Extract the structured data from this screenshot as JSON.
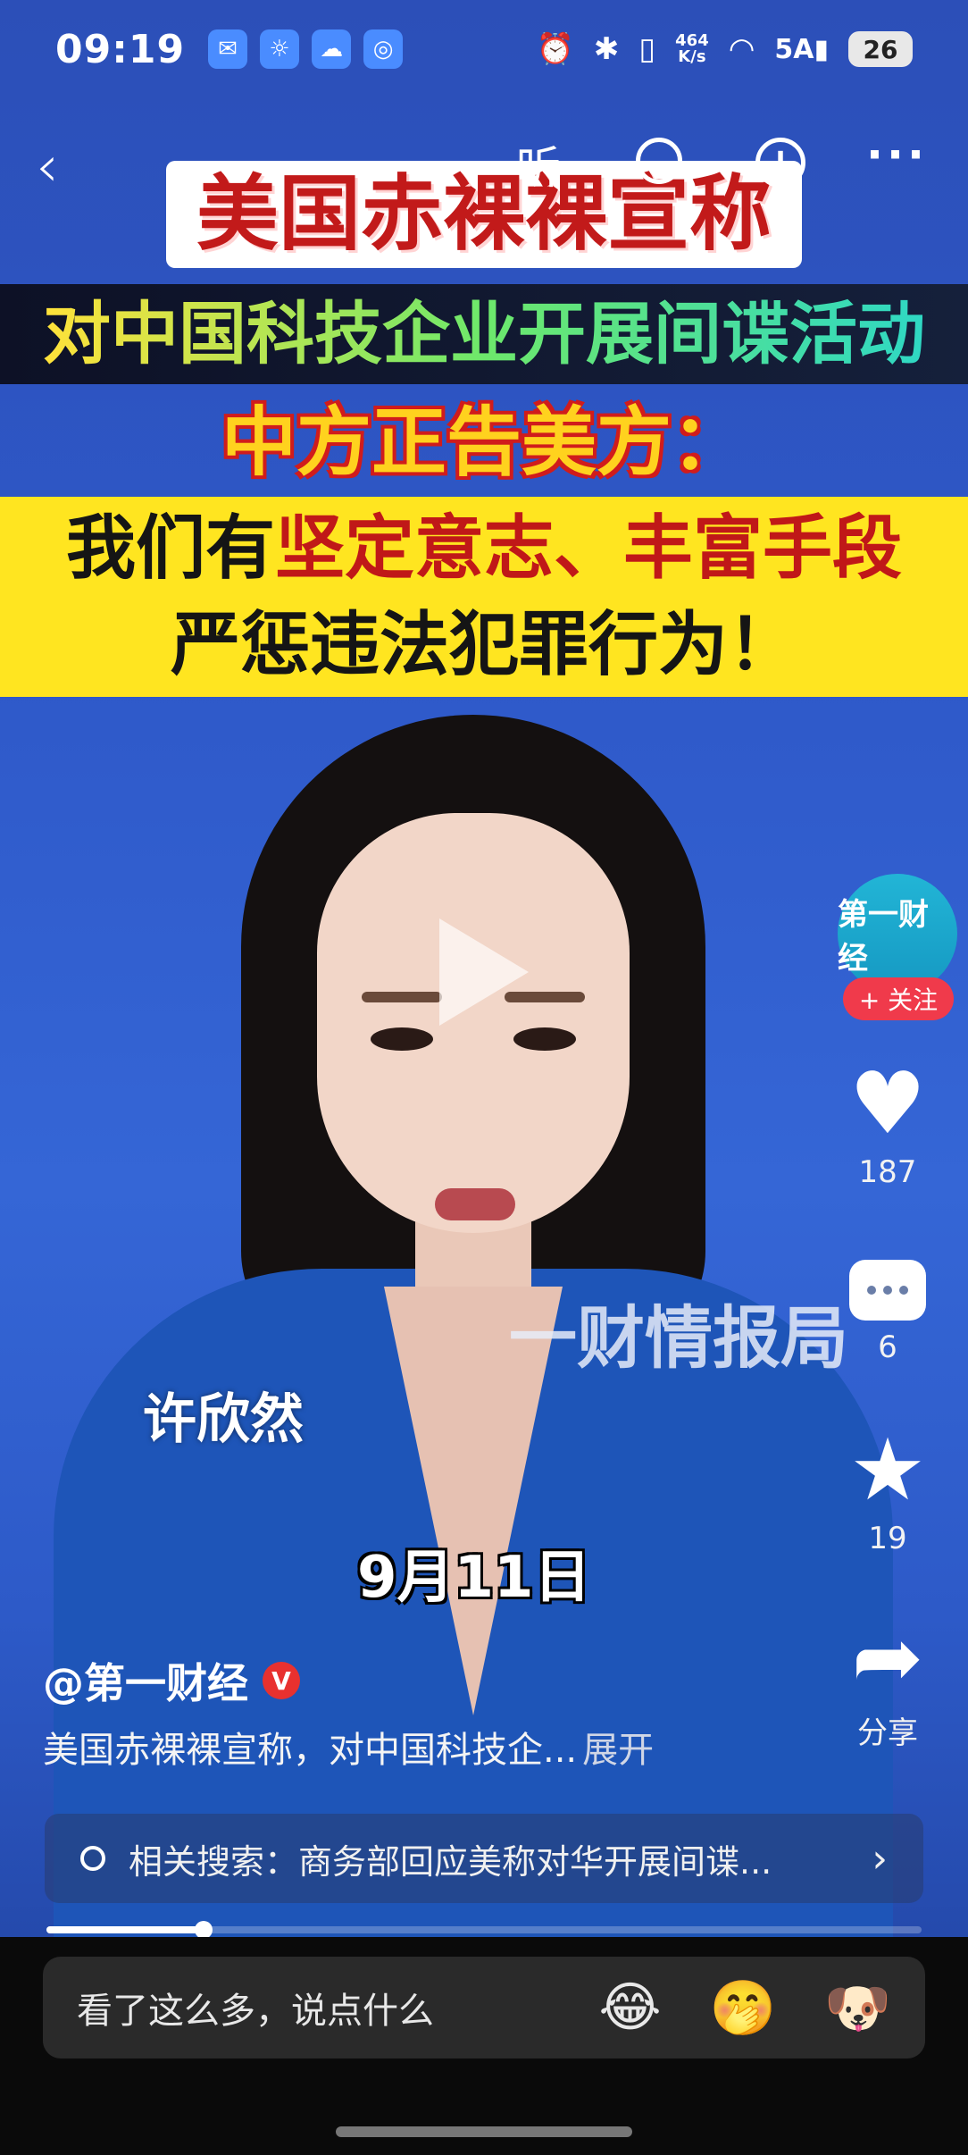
{
  "status": {
    "time": "09:19",
    "net_speed_top": "464",
    "net_speed_bottom": "K/s",
    "network": "5A",
    "battery": "26"
  },
  "topnav": {
    "listen_label": "听"
  },
  "headline": {
    "line1": "美国赤裸裸宣称",
    "line2": "对中国科技企业开展间谍活动",
    "line3": "中方正告美方：",
    "line4_prefix": "我们有",
    "line4_highlight": "坚定意志、丰富手段",
    "line5": "严惩违法犯罪行为！"
  },
  "video": {
    "watermark": "一财情报局",
    "presenter_name": "许欣然",
    "date": "9月11日",
    "progress": 0.18
  },
  "rail": {
    "avatar_text": "第一财经",
    "follow_label": "+ 关注",
    "likes": "187",
    "comments": "6",
    "favorites": "19",
    "share_label": "分享"
  },
  "caption": {
    "author": "@第一财经",
    "verified_badge": "V",
    "text": "美国赤裸裸宣称，对中国科技企...",
    "expand": "展开"
  },
  "related": {
    "text": "相关搜索：商务部回应美称对华开展间谍..."
  },
  "comment_bar": {
    "placeholder": "看了这么多，说点什么",
    "emojis": [
      "😂",
      "🤭",
      "🐶"
    ]
  }
}
